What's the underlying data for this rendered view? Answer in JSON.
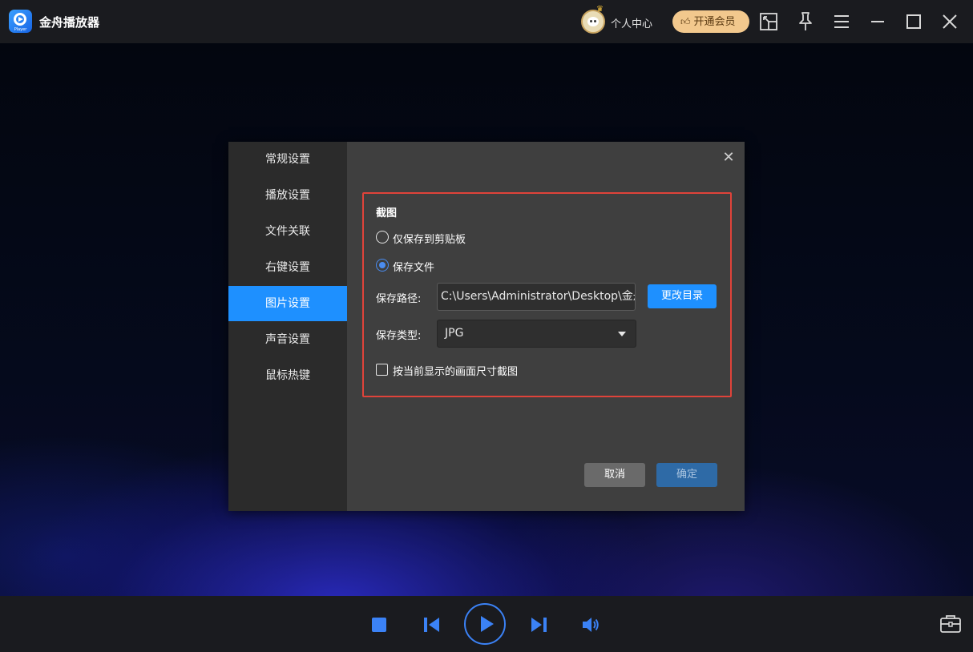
{
  "app": {
    "title": "金舟播放器",
    "logo_sub": "Player"
  },
  "header": {
    "user_center": "个人中心",
    "vip_button": "开通会员",
    "icons": [
      "avatar",
      "pip-icon",
      "pin-icon",
      "menu-icon",
      "minimize-icon",
      "maximize-icon",
      "close-icon"
    ]
  },
  "dialog": {
    "sidebar": [
      {
        "label": "常规设置",
        "active": false
      },
      {
        "label": "播放设置",
        "active": false
      },
      {
        "label": "文件关联",
        "active": false
      },
      {
        "label": "右键设置",
        "active": false
      },
      {
        "label": "图片设置",
        "active": true
      },
      {
        "label": "声音设置",
        "active": false
      },
      {
        "label": "鼠标热键",
        "active": false
      }
    ],
    "section_title": "截图",
    "option_clipboard": "仅保存到剪贴板",
    "option_file": "保存文件",
    "selected_option": "保存文件",
    "path_label": "保存路径:",
    "path_value": "C:\\Users\\Administrator\\Desktop\\金舟",
    "change_dir_button": "更改目录",
    "type_label": "保存类型:",
    "type_value": "JPG",
    "size_checkbox_label": "按当前显示的画面尺寸截图",
    "size_checkbox_checked": false,
    "cancel_button": "取消",
    "ok_button": "确定"
  },
  "colors": {
    "accent": "#1e90ff",
    "highlight_border": "#e0433a",
    "vip": "#f2c88d"
  },
  "controls": {
    "icons": [
      "stop-icon",
      "previous-icon",
      "play-icon",
      "next-icon",
      "volume-icon",
      "toolbox-icon"
    ]
  }
}
